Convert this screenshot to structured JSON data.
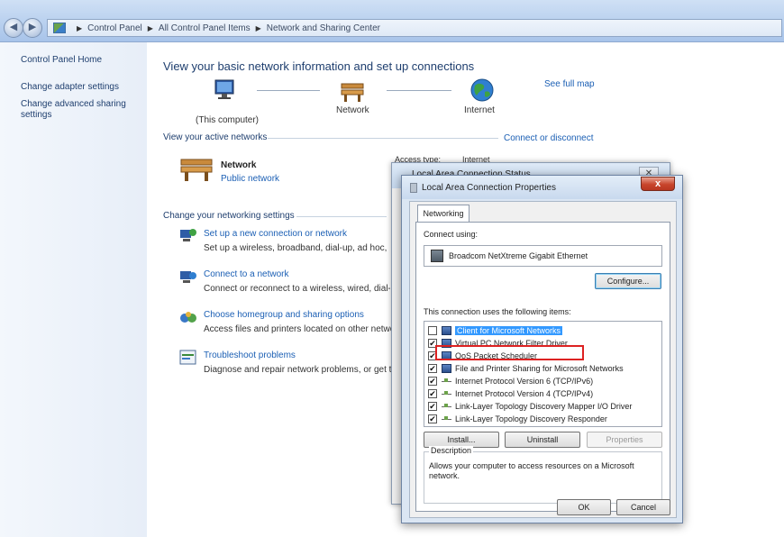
{
  "breadcrumb": [
    "Control Panel",
    "All Control Panel Items",
    "Network and Sharing Center"
  ],
  "left_pane": {
    "items": [
      "Control Panel Home",
      "Change adapter settings",
      "Change advanced sharing settings"
    ]
  },
  "main": {
    "heading": "View your basic network information and set up connections",
    "see_full_map": "See full map",
    "map": {
      "computer_label": "(This computer)",
      "network_label": "Network",
      "internet_label": "Internet"
    },
    "active_networks_label": "View your active networks",
    "connect_disconnect": "Connect or disconnect",
    "network_name": "Network",
    "network_type": "Public network",
    "change_settings_label": "Change your networking settings",
    "tasks": [
      {
        "title": "Set up a new connection or network",
        "desc": "Set up a wireless, broadband, dial-up, ad hoc, or"
      },
      {
        "title": "Connect to a network",
        "desc": "Connect or reconnect to a wireless, wired, dial-u"
      },
      {
        "title": "Choose homegroup and sharing options",
        "desc": "Access files and printers located on other netwo"
      },
      {
        "title": "Troubleshoot problems",
        "desc": "Diagnose and repair network problems, or get tr"
      }
    ]
  },
  "status_dialog": {
    "title": "Local Area Connection Status",
    "access_type_label": "Access type:",
    "access_type_value": "Internet"
  },
  "properties": {
    "title": "Local Area Connection Properties",
    "close": "x",
    "tab": "Networking",
    "connect_using_label": "Connect using:",
    "adapter": "Broadcom NetXtreme Gigabit Ethernet",
    "configure": "Configure...",
    "items_label": "This connection uses the following items:",
    "items": [
      {
        "label": "Client for Microsoft Networks",
        "checked": false,
        "icon": "network-client-icon"
      },
      {
        "label": "Virtual PC Network Filter Driver",
        "checked": true,
        "icon": "network-client-icon"
      },
      {
        "label": "QoS Packet Scheduler",
        "checked": true,
        "icon": "network-client-icon"
      },
      {
        "label": "File and Printer Sharing for Microsoft Networks",
        "checked": true,
        "icon": "network-client-icon"
      },
      {
        "label": "Internet Protocol Version 6 (TCP/IPv6)",
        "checked": true,
        "icon": "protocol-icon"
      },
      {
        "label": "Internet Protocol Version 4 (TCP/IPv4)",
        "checked": true,
        "icon": "protocol-icon"
      },
      {
        "label": "Link-Layer Topology Discovery Mapper I/O Driver",
        "checked": true,
        "icon": "protocol-icon"
      },
      {
        "label": "Link-Layer Topology Discovery Responder",
        "checked": true,
        "icon": "protocol-icon"
      }
    ],
    "install": "Install...",
    "uninstall": "Uninstall",
    "properties": "Properties",
    "description_label": "Description",
    "description_text": "Allows your computer to access resources on a Microsoft network.",
    "ok": "OK",
    "cancel": "Cancel"
  },
  "colors": {
    "link": "#1b5fb4",
    "highlight_border": "#dd2222",
    "selection": "#3399ff"
  }
}
